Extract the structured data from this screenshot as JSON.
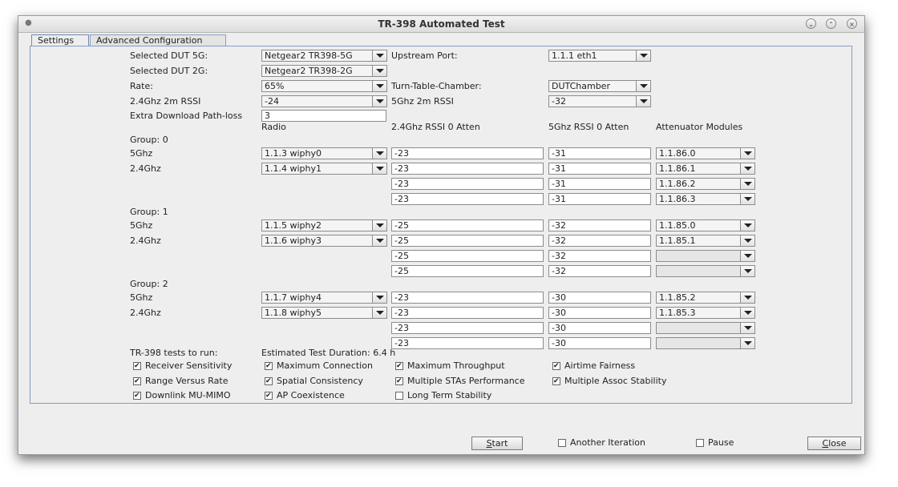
{
  "window": {
    "title": "TR-398 Automated Test"
  },
  "tabs": [
    "Settings",
    "Advanced Configuration"
  ],
  "top": {
    "dut5g_label": "Selected DUT 5G:",
    "dut5g_value": "Netgear2 TR398-5G",
    "dut2g_label": "Selected DUT 2G:",
    "dut2g_value": "Netgear2 TR398-2G",
    "rate_label": "Rate:",
    "rate_value": "65%",
    "rssi24_label": "2.4Ghz 2m RSSI",
    "rssi24_value": "-24",
    "pathloss_label": "Extra Download Path-loss",
    "pathloss_value": "3",
    "upstream_label": "Upstream Port:",
    "upstream_value": "1.1.1 eth1",
    "turntable_label": "Turn-Table-Chamber:",
    "turntable_value": "DUTChamber",
    "rssi5_label": "5Ghz 2m RSSI",
    "rssi5_value": "-32"
  },
  "columns": {
    "radio": "Radio",
    "atten24": "2.4Ghz RSSI 0 Atten",
    "atten5": "5Ghz RSSI 0 Atten",
    "modules": "Attenuator Modules"
  },
  "groups": [
    {
      "label": "Group: 0",
      "rows": [
        {
          "band": "5Ghz",
          "radio": "1.1.3 wiphy0",
          "a24": "-23",
          "a5": "-31",
          "module": "1.1.86.0"
        },
        {
          "band": "2.4Ghz",
          "radio": "1.1.4 wiphy1",
          "a24": "-23",
          "a5": "-31",
          "module": "1.1.86.1"
        },
        {
          "band": "",
          "radio": "",
          "a24": "-23",
          "a5": "-31",
          "module": "1.1.86.2"
        },
        {
          "band": "",
          "radio": "",
          "a24": "-23",
          "a5": "-31",
          "module": "1.1.86.3"
        }
      ]
    },
    {
      "label": "Group: 1",
      "rows": [
        {
          "band": "5Ghz",
          "radio": "1.1.5 wiphy2",
          "a24": "-25",
          "a5": "-32",
          "module": "1.1.85.0"
        },
        {
          "band": "2.4Ghz",
          "radio": "1.1.6 wiphy3",
          "a24": "-25",
          "a5": "-32",
          "module": "1.1.85.1"
        },
        {
          "band": "",
          "radio": "",
          "a24": "-25",
          "a5": "-32",
          "module": ""
        },
        {
          "band": "",
          "radio": "",
          "a24": "-25",
          "a5": "-32",
          "module": ""
        }
      ]
    },
    {
      "label": "Group: 2",
      "rows": [
        {
          "band": "5Ghz",
          "radio": "1.1.7 wiphy4",
          "a24": "-23",
          "a5": "-30",
          "module": "1.1.85.2"
        },
        {
          "band": "2.4Ghz",
          "radio": "1.1.8 wiphy5",
          "a24": "-23",
          "a5": "-30",
          "module": "1.1.85.3"
        },
        {
          "band": "",
          "radio": "",
          "a24": "-23",
          "a5": "-30",
          "module": ""
        },
        {
          "band": "",
          "radio": "",
          "a24": "-23",
          "a5": "-30",
          "module": ""
        }
      ]
    }
  ],
  "tests": {
    "label": "TR-398 tests to run:",
    "duration": "Estimated Test Duration: 6.4 h",
    "items": [
      {
        "label": "Receiver Sensitivity",
        "checked": true
      },
      {
        "label": "Maximum Connection",
        "checked": true
      },
      {
        "label": "Maximum Throughput",
        "checked": true
      },
      {
        "label": "Airtime Fairness",
        "checked": true
      },
      {
        "label": "Range Versus Rate",
        "checked": true
      },
      {
        "label": "Spatial Consistency",
        "checked": true
      },
      {
        "label": "Multiple STAs Performance",
        "checked": true
      },
      {
        "label": "Multiple Assoc Stability",
        "checked": true
      },
      {
        "label": "Downlink MU-MIMO",
        "checked": true
      },
      {
        "label": "AP Coexistence",
        "checked": true
      },
      {
        "label": "Long Term Stability",
        "checked": false
      }
    ]
  },
  "footer": {
    "start_mnemonic": "S",
    "start_rest": "tart",
    "another_iteration": "Another Iteration",
    "another_iteration_checked": false,
    "pause": "Pause",
    "pause_checked": false,
    "close_mnemonic": "C",
    "close_rest": "lose"
  }
}
